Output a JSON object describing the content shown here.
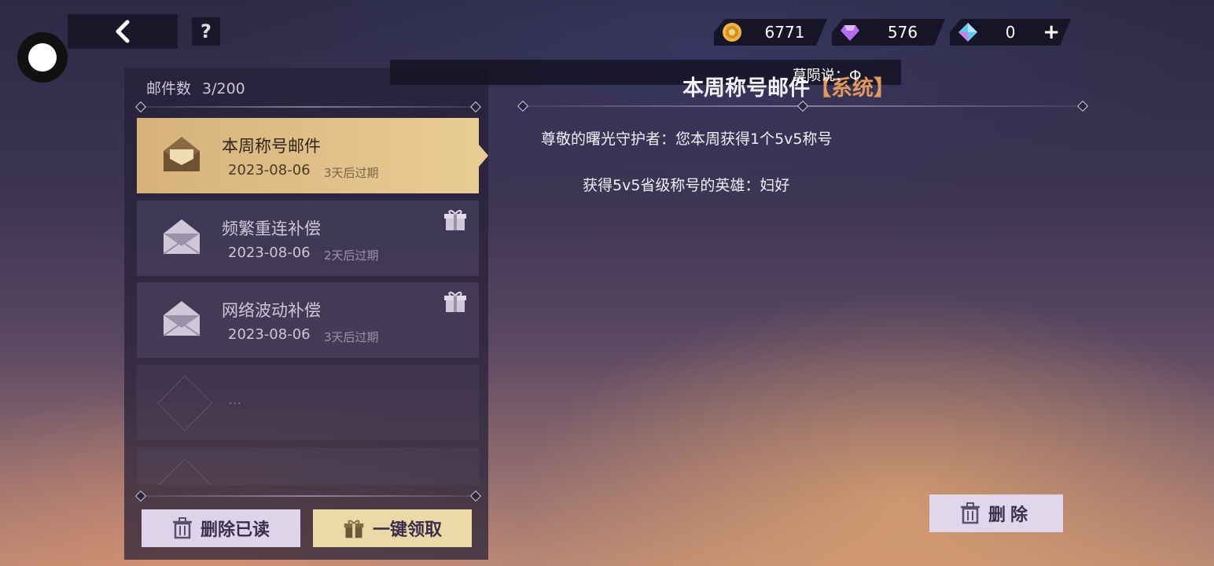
{
  "header": {
    "back_icon": "chevron-left-icon",
    "help_label": "?"
  },
  "currencies": [
    {
      "icon": "gold-coin-icon",
      "value": "6771",
      "color": "#f0b43a"
    },
    {
      "icon": "purple-gem-icon",
      "value": "576",
      "color": "#b56cf0"
    },
    {
      "icon": "blue-crystal-icon",
      "value": "0",
      "color": "#5ec8f0"
    }
  ],
  "currency_plus": "+",
  "mailbox": {
    "count_label": "邮件数",
    "count_value": "3/200",
    "items": [
      {
        "title": "本周称号邮件",
        "date": "2023-08-06",
        "expiry": "3天后过期",
        "selected": true,
        "has_gift": false
      },
      {
        "title": "频繁重连补偿",
        "date": "2023-08-06",
        "expiry": "2天后过期",
        "selected": false,
        "has_gift": true
      },
      {
        "title": "网络波动补偿",
        "date": "2023-08-06",
        "expiry": "3天后过期",
        "selected": false,
        "has_gift": true
      }
    ],
    "empty_placeholder": "...",
    "delete_read_label": "删除已读",
    "claim_all_label": "一键领取"
  },
  "notice": {
    "text": "莫陨说：Ф"
  },
  "detail": {
    "title": "本周称号邮件",
    "tag": "【系统】",
    "line1": "尊敬的曙光守护者：您本周获得1个5v5称号",
    "line2": "获得5v5省级称号的英雄：妇好",
    "delete_label": "删除"
  }
}
